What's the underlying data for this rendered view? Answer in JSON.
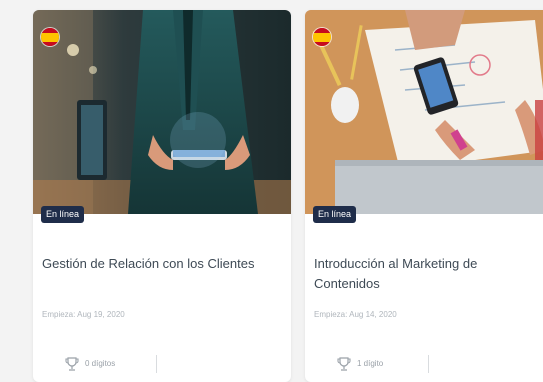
{
  "courses": [
    {
      "mode": "En línea",
      "title": "Gestión de Relación con los Clientes",
      "start": "Empieza: Aug 19, 2020",
      "digits": "0 dígitos",
      "flag_icon": "spain-flag-icon",
      "image": "person-holding-tablet-photo"
    },
    {
      "mode": "En línea",
      "title": "Introducción al Marketing de Contenidos",
      "start": "Empieza: Aug 14, 2020",
      "digits": "1 dígito",
      "flag_icon": "spain-flag-icon",
      "image": "desk-with-notes-and-phone-photo"
    }
  ],
  "colors": {
    "badge_bg": "#1f2d4a",
    "title_text": "#3e4a55",
    "muted_text": "#b0b6bc"
  }
}
